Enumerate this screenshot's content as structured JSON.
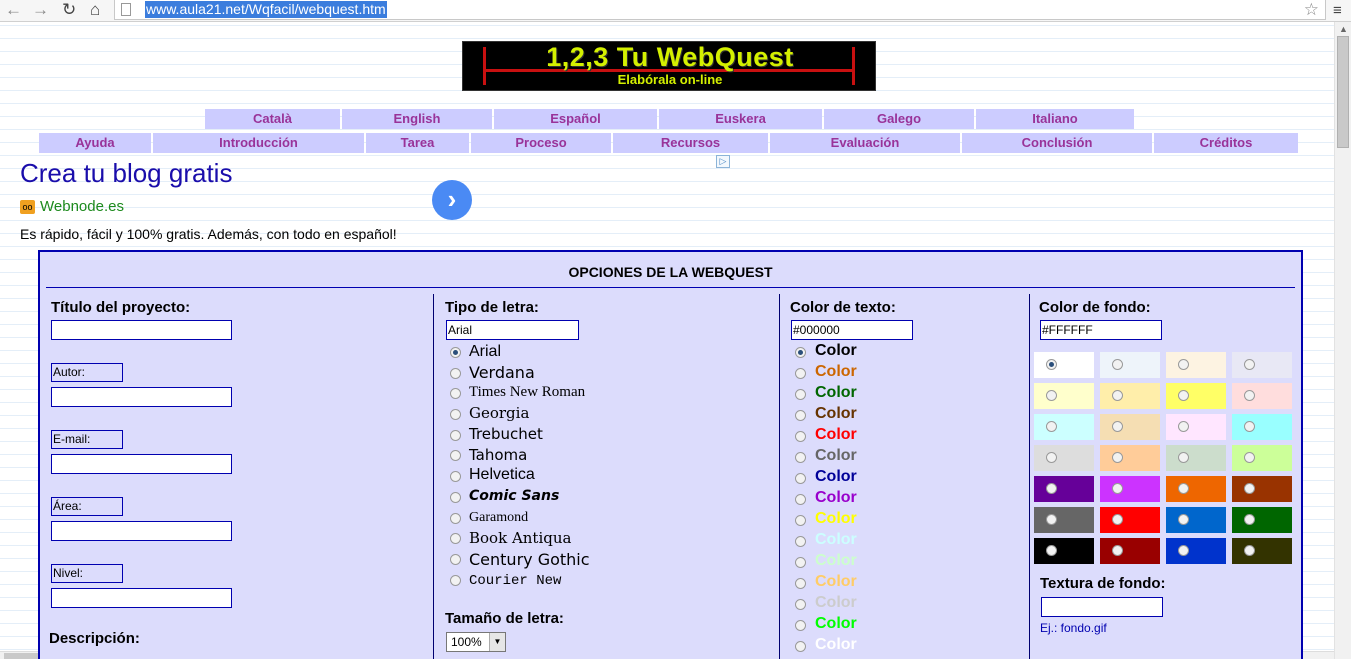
{
  "browser": {
    "url": "www.aula21.net/Wqfacil/webquest.htm"
  },
  "logo": {
    "title": "1,2,3 Tu WebQuest",
    "subtitle": "Elabórala on-line"
  },
  "languages": [
    "Català",
    "English",
    "Español",
    "Euskera",
    "Galego",
    "Italiano"
  ],
  "sections": [
    "Ayuda",
    "Introducción",
    "Tarea",
    "Proceso",
    "Recursos",
    "Evaluación",
    "Conclusión",
    "Créditos"
  ],
  "ad": {
    "title": "Crea tu blog gratis",
    "site": "Webnode.es",
    "description": "Es rápido, fácil y 100% gratis. Además, con todo en español!"
  },
  "panel": {
    "title": "OPCIONES DE LA WEBQUEST",
    "project": {
      "title_label": "Título del proyecto:",
      "author_label": "Autor:",
      "email_label": "E-mail:",
      "area_label": "Área:",
      "level_label": "Nivel:",
      "description_label": "Descripción:"
    },
    "font": {
      "label": "Tipo de letra:",
      "value": "Arial",
      "options": [
        "Arial",
        "Verdana",
        "Times New Roman",
        "Georgia",
        "Trebuchet",
        "Tahoma",
        "Helvetica",
        "Comic Sans",
        "Garamond",
        "Book Antiqua",
        "Century Gothic",
        "Courier New"
      ],
      "size_label": "Tamaño de letra:",
      "size_value": "100%"
    },
    "text_color": {
      "label": "Color de texto:",
      "value": "#000000",
      "option_label": "Color",
      "colors": [
        "#000000",
        "#cc6600",
        "#006600",
        "#663300",
        "#ff0000",
        "#666666",
        "#000099",
        "#9900cc",
        "#ffff00",
        "#ccffff",
        "#ccffcc",
        "#ffcc66",
        "#cccccc",
        "#00ff00",
        "#ffffff"
      ]
    },
    "bg_color": {
      "label": "Color de fondo:",
      "value": "#FFFFFF",
      "swatches": [
        "#ffffff",
        "#eef4fa",
        "#fdf3e2",
        "#e8e8f5",
        "#ffffcc",
        "#ffeeaa",
        "#ffff66",
        "#ffdddd",
        "#ccffff",
        "#f5deb3",
        "#ffe6ff",
        "#99ffff",
        "#dddddd",
        "#ffcc99",
        "#ccddcc",
        "#ccff99",
        "#660099",
        "#cc33ff",
        "#ee6600",
        "#993300",
        "#666666",
        "#ff0000",
        "#0066cc",
        "#006600",
        "#000000",
        "#990000",
        "#0033cc",
        "#333300"
      ],
      "texture_label": "Textura de fondo:",
      "texture_hint": "Ej.: fondo.gif"
    }
  }
}
